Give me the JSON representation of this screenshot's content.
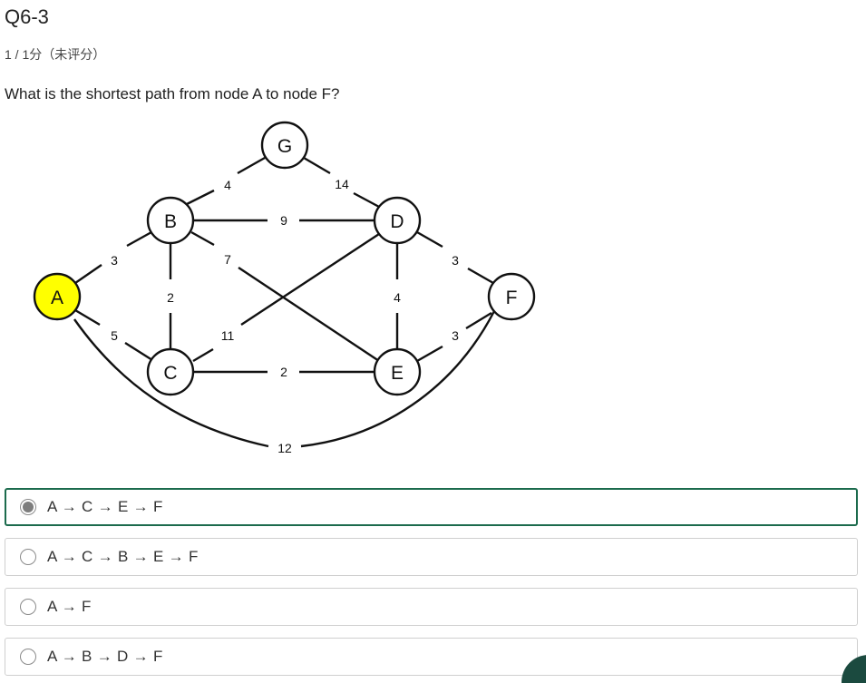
{
  "question": {
    "title": "Q6-3",
    "score": "1 / 1分（未评分）",
    "text": "What is the shortest path from node A to node F?"
  },
  "graph": {
    "nodes": {
      "A": "A",
      "B": "B",
      "C": "C",
      "D": "D",
      "E": "E",
      "F": "F",
      "G": "G"
    },
    "highlight_color": "#ffff00",
    "edge_weights": {
      "AB": "3",
      "AC": "5",
      "AF": "12",
      "BG": "4",
      "BD": "9",
      "BE": "7",
      "BC": "2",
      "CD": "11",
      "CE": "2",
      "GD": "14",
      "DE": "4",
      "DF": "3",
      "EF": "3"
    }
  },
  "options": [
    {
      "label": "A → C → E → F",
      "selected": true
    },
    {
      "label": "A → C → B → E → F",
      "selected": false
    },
    {
      "label": "A → F",
      "selected": false
    },
    {
      "label": "A → B → D → F",
      "selected": false
    }
  ],
  "colors": {
    "selected_border": "#1c6b4d",
    "badge": "#1b4a3f"
  }
}
